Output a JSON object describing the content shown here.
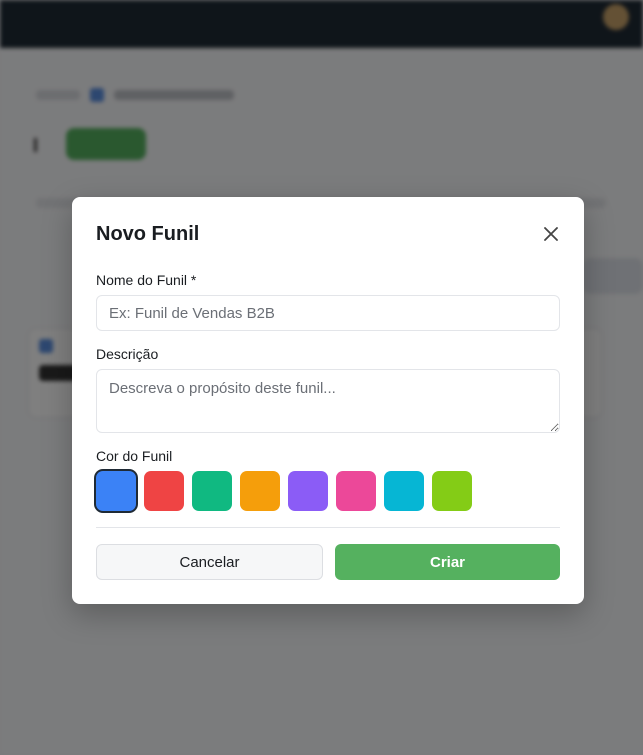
{
  "modal": {
    "title": "Novo Funil",
    "name_label": "Nome do Funil *",
    "name_placeholder": "Ex: Funil de Vendas B2B",
    "name_value": "",
    "description_label": "Descrição",
    "description_placeholder": "Descreva o propósito deste funil...",
    "description_value": "",
    "color_label": "Cor do Funil",
    "colors": [
      {
        "name": "blue",
        "hex": "#3b82f6",
        "selected": true
      },
      {
        "name": "red",
        "hex": "#ef4444",
        "selected": false
      },
      {
        "name": "green",
        "hex": "#10b981",
        "selected": false
      },
      {
        "name": "orange",
        "hex": "#f59e0b",
        "selected": false
      },
      {
        "name": "purple",
        "hex": "#8b5cf6",
        "selected": false
      },
      {
        "name": "pink",
        "hex": "#ec4899",
        "selected": false
      },
      {
        "name": "cyan",
        "hex": "#06b6d4",
        "selected": false
      },
      {
        "name": "lime",
        "hex": "#84cc16",
        "selected": false
      }
    ],
    "cancel_label": "Cancelar",
    "create_label": "Criar",
    "close_icon": "close-icon"
  },
  "theme": {
    "primary_green": "#55b15f",
    "topbar": "#1f2a35"
  }
}
